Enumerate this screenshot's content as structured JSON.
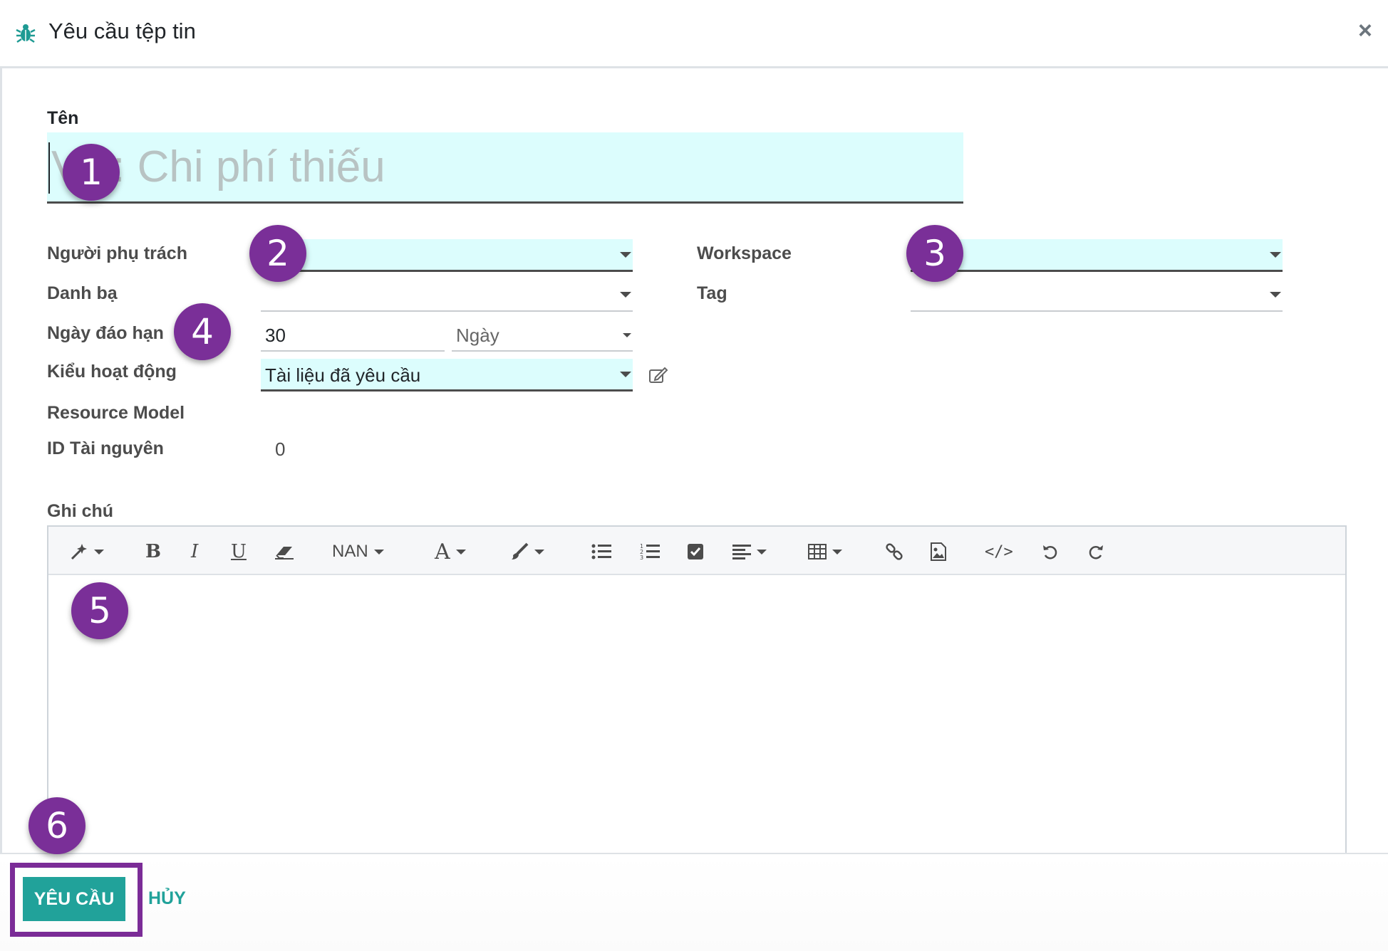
{
  "header": {
    "title": "Yêu cầu tệp tin",
    "close_label": "×",
    "icon": "bug-icon"
  },
  "form": {
    "name_label": "Tên",
    "name_placeholder": "VD: Chi phí thiếu",
    "owner_label": "Người phụ trách",
    "owner_value": "",
    "workspace_label": "Workspace",
    "workspace_value": "",
    "contact_label": "Danh bạ",
    "contact_value": "",
    "tag_label": "Tag",
    "tag_value": "",
    "due_label": "Ngày đáo hạn",
    "due_value": "30",
    "due_unit": "Ngày",
    "activity_type_label": "Kiểu hoạt động",
    "activity_type_value": "Tài liệu đã yêu cầu",
    "resource_model_label": "Resource Model",
    "resource_id_label": "ID Tài nguyên",
    "resource_id_value": "0",
    "notes_label": "Ghi chú"
  },
  "toolbar": {
    "font_size_label": "NAN",
    "font_color_label": "A",
    "items": [
      "magic-wand-icon",
      "bold-icon",
      "italic-icon",
      "underline-icon",
      "eraser-icon",
      "font-size-dropdown",
      "font-color-dropdown",
      "brush-icon",
      "bullet-list-icon",
      "numbered-list-icon",
      "checklist-icon",
      "align-icon",
      "table-icon",
      "link-icon",
      "image-icon",
      "code-view-icon",
      "undo-icon",
      "redo-icon"
    ]
  },
  "footer": {
    "primary_label": "YÊU CẦU",
    "cancel_label": "HỦY"
  },
  "callouts": [
    "1",
    "2",
    "3",
    "4",
    "5",
    "6"
  ],
  "colors": {
    "accent": "#21a29a",
    "required_bg": "#dcfdfd",
    "callout": "#7a2f98"
  }
}
